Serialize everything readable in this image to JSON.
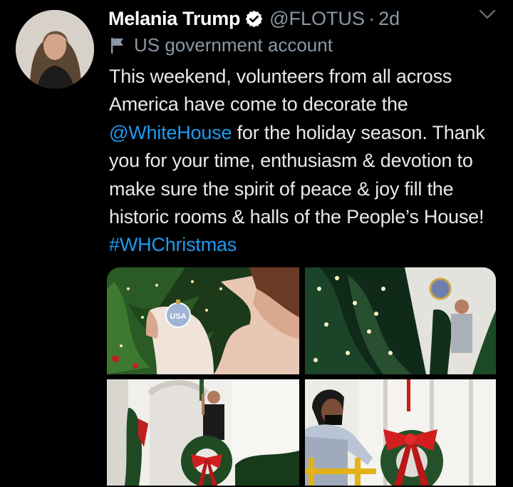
{
  "author": {
    "name": "Melania Trump",
    "handle": "@FLOTUS",
    "separator": "·",
    "time": "2d",
    "label": "US government account"
  },
  "tweet": {
    "part1": "This weekend, volunteers from all across America have come to decorate the ",
    "mention": "@WhiteHouse",
    "part2": " for the holiday season. Thank you for your time, enthusiasm & devotion to make sure the spirit of peace & joy fill the historic rooms & halls of the People’s House! ",
    "hashtag": "#WHChristmas"
  },
  "media": {
    "ornament_text": "USA"
  },
  "colors": {
    "background": "#000000",
    "link": "#1d9bf0",
    "secondary_text": "#8b98a5",
    "verified_badge": "#ffffff"
  },
  "icons": [
    "verified-badge-icon",
    "chevron-down-icon",
    "government-flag-icon"
  ]
}
